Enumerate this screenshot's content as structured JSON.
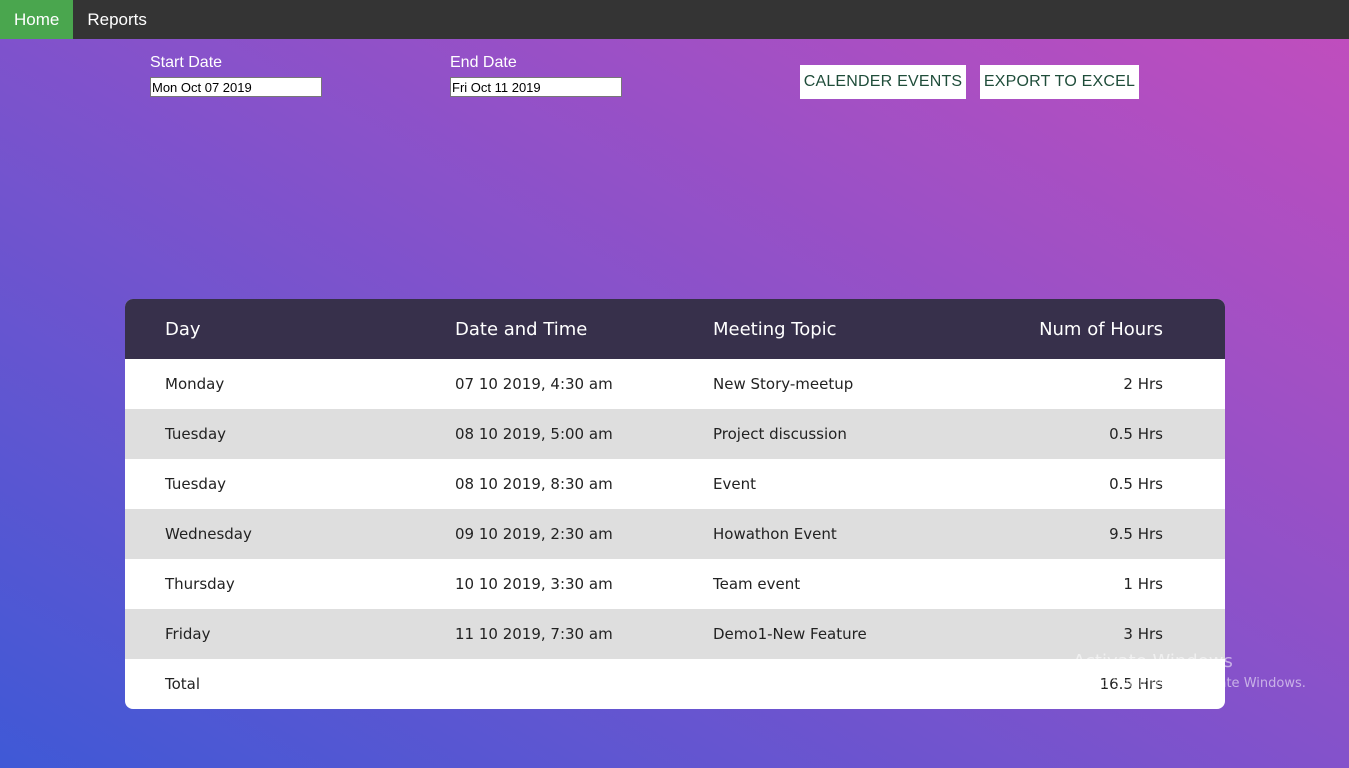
{
  "nav": {
    "items": [
      {
        "label": "Home",
        "active": true
      },
      {
        "label": "Reports",
        "active": false
      }
    ],
    "active_color": "#4aa64e"
  },
  "filters": {
    "start_label": "Start Date",
    "start_value": "Mon Oct 07 2019",
    "end_label": "End Date",
    "end_value": "Fri Oct 11 2019"
  },
  "actions": {
    "calendar_events": "CALENDER EVENTS",
    "export_excel": "EXPORT TO EXCEL"
  },
  "table": {
    "headers": [
      "Day",
      "Date and Time",
      "Meeting Topic",
      "Num of Hours"
    ],
    "rows": [
      {
        "day": "Monday",
        "datetime": "07 10 2019, 4:30 am",
        "topic": "New Story-meetup",
        "hours": "2 Hrs"
      },
      {
        "day": "Tuesday",
        "datetime": "08 10 2019, 5:00 am",
        "topic": "Project discussion",
        "hours": "0.5 Hrs"
      },
      {
        "day": "Tuesday",
        "datetime": "08 10 2019, 8:30 am",
        "topic": "Event",
        "hours": "0.5 Hrs"
      },
      {
        "day": "Wednesday",
        "datetime": "09 10 2019, 2:30 am",
        "topic": "Howathon Event",
        "hours": "9.5 Hrs"
      },
      {
        "day": "Thursday",
        "datetime": "10 10 2019, 3:30 am",
        "topic": "Team event",
        "hours": "1 Hrs"
      },
      {
        "day": "Friday",
        "datetime": "11 10 2019, 7:30 am",
        "topic": "Demo1-New Feature",
        "hours": "3 Hrs"
      }
    ],
    "total_label": "Total",
    "total_value": "16.5 Hrs",
    "header_color": "#37304b"
  },
  "watermark": {
    "title": "Activate Windows",
    "subtitle": "Go to Settings to activate Windows."
  }
}
